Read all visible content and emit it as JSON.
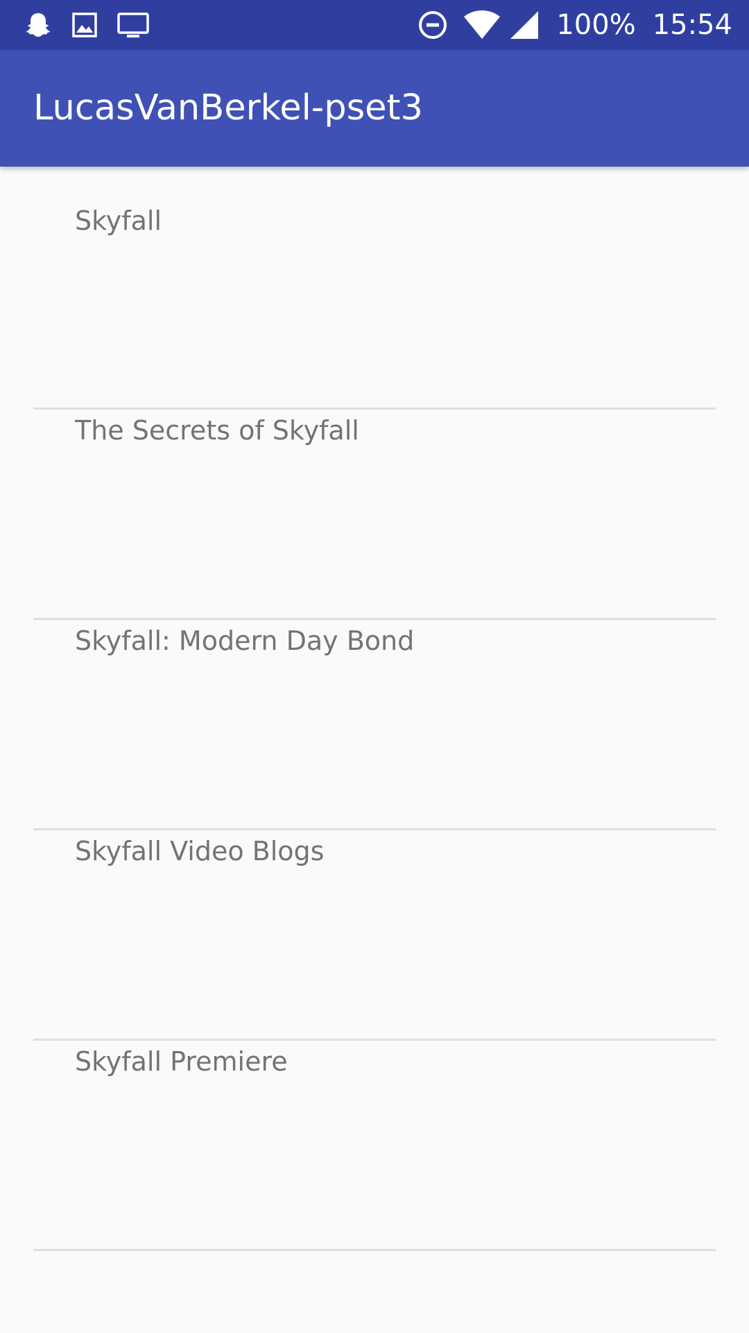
{
  "status_bar": {
    "icons_left": [
      "snapchat-ghost-icon",
      "image-icon",
      "monitor-icon"
    ],
    "icons_right": [
      "do-not-disturb-icon",
      "wifi-icon",
      "signal-icon"
    ],
    "battery": "100%",
    "time": "15:54",
    "colors": {
      "background": "#303f9f",
      "foreground": "#ffffff"
    }
  },
  "app_bar": {
    "title": "LucasVanBerkel-pset3",
    "color": "#3f51b5"
  },
  "list": {
    "items": [
      {
        "label": "Skyfall"
      },
      {
        "label": "The Secrets of Skyfall"
      },
      {
        "label": "Skyfall: Modern Day Bond"
      },
      {
        "label": "Skyfall Video Blogs"
      },
      {
        "label": "Skyfall Premiere"
      }
    ]
  }
}
